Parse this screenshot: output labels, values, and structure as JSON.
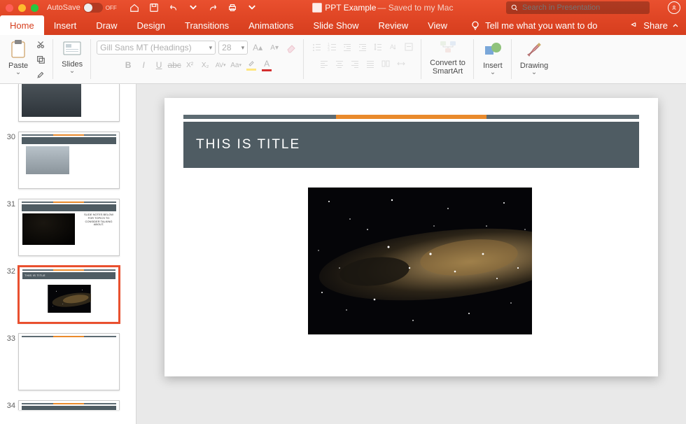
{
  "titlebar": {
    "autosave": "AutoSave",
    "off": "OFF",
    "docname": "PPT Example",
    "docstatus": "— Saved to my Mac"
  },
  "search": {
    "placeholder": "Search in Presentation"
  },
  "tabs": {
    "home": "Home",
    "insert": "Insert",
    "draw": "Draw",
    "design": "Design",
    "transitions": "Transitions",
    "animations": "Animations",
    "slideshow": "Slide Show",
    "review": "Review",
    "view": "View"
  },
  "tellme": "Tell me what you want to do",
  "share": "Share",
  "ribbon": {
    "paste": "Paste",
    "slides": "Slides",
    "fontname": "Gill Sans MT (Headings)",
    "fontsize": "28",
    "convert1": "Convert to",
    "convert2": "SmartArt",
    "insert": "Insert",
    "drawing": "Drawing"
  },
  "thumbs": {
    "n30": "30",
    "n31": "31",
    "n32": "32",
    "n33": "33",
    "n34": "34",
    "t32": "THIS IS TITLE",
    "note31": "SLIDE NOTES BELOW FOR TOPICS TO CONSIDER TALKING ABOUT."
  },
  "slide": {
    "title": "THIS IS TITLE"
  }
}
